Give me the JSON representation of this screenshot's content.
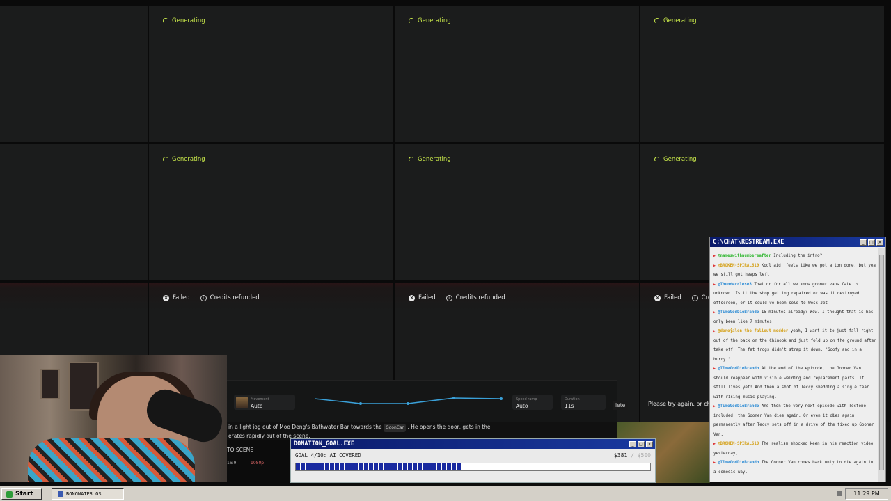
{
  "grid": {
    "generating_label": "Generating",
    "failed_label": "Failed",
    "refunded_label": "Credits refunded",
    "retry_text": "Please try again, or char",
    "partial_refund_label": "Credi"
  },
  "editor": {
    "movement_label": "Movement",
    "movement_value": "Auto",
    "speed_ramp_label": "Speed ramp",
    "speed_ramp_value": "Auto",
    "duration_label": "Duration",
    "duration_value": "11s",
    "delete_label": "lete",
    "prompt_line1_a": "in a light jog out of Moo Deng's Bathwater Bar towards the",
    "prompt_chip": "GoonCar",
    "prompt_line1_b": ". He opens the door, gets in the",
    "prompt_line2": "erates rapidly out of the scene.",
    "scene_label": "TO SCENE",
    "aspect_label": "16:9",
    "quality_label": "1080p"
  },
  "donation": {
    "title": "DONATION_GOAL.EXE",
    "goal_label": "GOAL 4/10: AI COVERED",
    "raised": "$381",
    "target": "/ $500",
    "progress_fraction": 0.47
  },
  "chat": {
    "title": "C:\\CHAT\\RESTREAM.EXE",
    "messages": [
      {
        "user": "@nameswithnumbersafter",
        "color": "#2bb52b",
        "text": "Including the intro?"
      },
      {
        "user": "@BROKEN-SPIRAL619",
        "color": "#d4a017",
        "text": "Kool aid, feels like we got a ton done, but yea we still got heaps left"
      },
      {
        "user": "@Thunderclese3",
        "color": "#2a8ad4",
        "text": "That or for all we know gooner vans fate is unknown. Is it the shop getting repaired or was it destroyed offscreen, or it could've been sold to Wess Jet"
      },
      {
        "user": "@TimeGodDieBrando",
        "color": "#2a8ad4",
        "text": "15 minutes already? Wow. I thought that is has only been like 7 minutes."
      },
      {
        "user": "@derojalen_the_fallout_modder",
        "color": "#d4a017",
        "text": "yeah, I want it to just fall right out of the back on the Chinook and just fold up on the ground after take off. The fat frogs didn't strap it down. \"Goofy and in a hurry.\""
      },
      {
        "user": "@TimeGodDieBrando",
        "color": "#2a8ad4",
        "text": "At the end of the episode, the Gooner Van should reappear with visible welding and replacement parts. It still lives yet! And then a shot of Teccy shedding a single tear with rising music playing."
      },
      {
        "user": "@TimeGodDieBrando",
        "color": "#2a8ad4",
        "text": "And then the very next episode with Tectone included, the Gooner Van dies again. Or even it dies again permanently after Teccy sets off in a drive of the fixed up Gooner Van."
      },
      {
        "user": "@BROKEN-SPIRAL619",
        "color": "#d4a017",
        "text": "The realism shocked keen in his reaction video yesterday,"
      },
      {
        "user": "@TimeGodDieBrando",
        "color": "#2a8ad4",
        "text": "The Gooner Van comes back only to die again in a comedic way."
      }
    ]
  },
  "taskbar": {
    "start_label": "Start",
    "task_label": "BONGWATER.OS",
    "clock": "11:29 PM"
  },
  "colors": {
    "accent_green": "#c9e84a",
    "titlebar_blue": "#0a1a6a",
    "progress_blue": "#1a2aa0"
  },
  "icons": [
    "spinner-icon",
    "failed-icon",
    "info-icon",
    "start-icon",
    "task-icon"
  ]
}
